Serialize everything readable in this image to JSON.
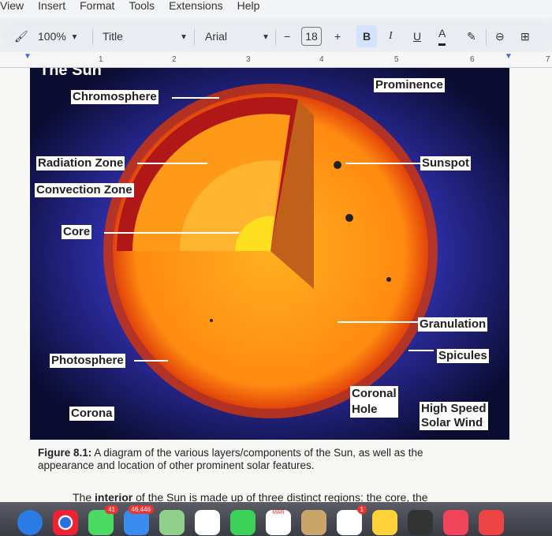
{
  "menu": [
    "View",
    "Insert",
    "Format",
    "Tools",
    "Extensions",
    "Help"
  ],
  "toolbar": {
    "zoom": "100%",
    "style": "Title",
    "font": "Arial",
    "font_size": "18",
    "minus": "−",
    "plus": "+",
    "bold": "B",
    "italic": "I",
    "underline": "U",
    "text_color": "A"
  },
  "ruler": [
    "1",
    "2",
    "3",
    "4",
    "5",
    "6",
    "7"
  ],
  "figure": {
    "title": "The Sun",
    "labels": {
      "chromosphere": "Chromosphere",
      "prominence": "Prominence",
      "radiation_zone": "Radiation Zone",
      "sunspot": "Sunspot",
      "convection_zone": "Convection Zone",
      "core": "Core",
      "granulation": "Granulation",
      "spicules": "Spicules",
      "photosphere": "Photosphere",
      "coronal_hole_1": "Coronal",
      "coronal_hole_2": "Hole",
      "corona": "Corona",
      "solar_wind_1": "High Speed",
      "solar_wind_2": "Solar Wind"
    }
  },
  "caption": {
    "label": "Figure 8.1:",
    "text": " A diagram of the various layers/components of the Sun, as well as the appearance and location of other prominent solar features."
  },
  "paragraph": {
    "before": "The ",
    "bold": "interior",
    "after": " of the Sun is made up of three distinct regions: the core, the"
  },
  "dock": {
    "messages_badge": "41",
    "mail_badge": "46,446",
    "calendar_month": "MAR",
    "reminders_badge": "1"
  }
}
